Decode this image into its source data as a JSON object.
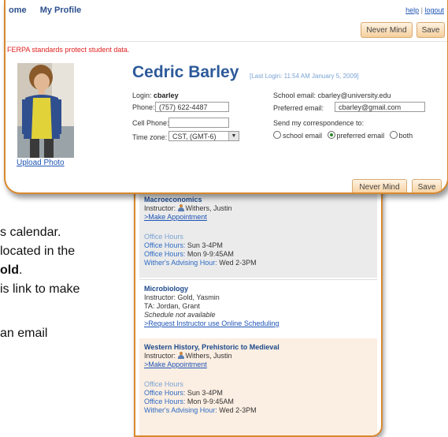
{
  "document": {
    "line1": "s calendar.",
    "line2": "located in the",
    "line3_bold": "old",
    "line3_end": ".",
    "line4": "is link to make",
    "line5": "an email"
  },
  "profile": {
    "nav": [
      "ome",
      "My Profile"
    ],
    "help_link": "help",
    "separator": "|",
    "logout_link": "logout",
    "never_mind_label": "Never Mind",
    "save_label": "Save",
    "ferpa_notice": "FERPA standards protect student data.",
    "upload_photo": "Upload Photo",
    "name": "Cedric Barley",
    "last_login": "[Last Login: 11:54 AM January 5, 2009]",
    "login_label": "Login:",
    "login_value": "cbarley",
    "phone_label": "Phone:",
    "phone_value": "(757) 622-4487",
    "cell_label": "Cell Phone:",
    "cell_value": "",
    "timezone_label": "Time zone:",
    "timezone_value": "CST, (GMT-6)",
    "school_email_label": "School email:",
    "school_email_value": "cbarley@university.edu",
    "preferred_email_label": "Preferred email:",
    "preferred_email_value": "cbarley@gmail.com",
    "correspondence_label": "Send my correspondence to:",
    "radio_options": [
      "school email",
      "preferred email",
      "both"
    ],
    "radio_selected": "preferred email"
  },
  "schedule": {
    "courses": [
      {
        "title": "Macroeconomics",
        "instructor_label": "Instructor:",
        "instructor": "Withers, Justin",
        "action": ">Make Appointment",
        "office_hours_head": "Office Hours",
        "hours": [
          {
            "label": "Office Hours:",
            "value": "Sun 3-4PM"
          },
          {
            "label": "Office Hours:",
            "value": "Mon 9-9:45AM"
          },
          {
            "label": "Wither's Advising Hour:",
            "value": "Wed 2-3PM"
          }
        ]
      },
      {
        "title": "Microbiology",
        "instructor_line": "Instructor: Gold, Yasmin",
        "ta_line": "TA: Jordan, Grant",
        "note": "Schedule not available",
        "action": ">Request Instructor use Online Scheduling"
      },
      {
        "title": "Western History, Prehistoric to Medieval",
        "instructor_label": "Instructor:",
        "instructor": "Withers, Justin",
        "action": ">Make Appointment",
        "office_hours_head": "Office Hours",
        "hours": [
          {
            "label": "Office Hours:",
            "value": "Sun 3-4PM"
          },
          {
            "label": "Office Hours:",
            "value": "Mon 9-9:45AM"
          },
          {
            "label": "Wither's Advising Hour:",
            "value": "Wed 2-3PM"
          }
        ]
      }
    ]
  },
  "colors": {
    "accent_border": "#d9892e",
    "title_blue": "#2d5a9a",
    "link_blue": "#1f55b6",
    "ferpa_red": "#e02020"
  }
}
